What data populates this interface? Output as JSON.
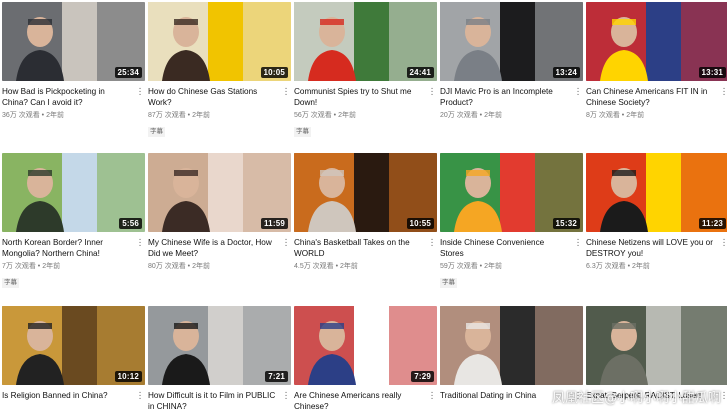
{
  "videos": [
    {
      "title": "How Bad is Pickpocketing in China? Can I avoid it?",
      "duration": "25:34",
      "views": "36万 次观看",
      "age": "2年前",
      "badge": "",
      "thumb_icon": "man-suit-thumbnail",
      "colors": [
        "#5a5e64",
        "#c9c4bd",
        "#2b2d33"
      ]
    },
    {
      "title": "How do Chinese Gas Stations Work?",
      "duration": "10:05",
      "views": "87万 次观看",
      "age": "2年前",
      "badge": "字幕",
      "thumb_icon": "gas-nozzle-thumbnail",
      "colors": [
        "#e8e4de",
        "#f1c400",
        "#3a2a22"
      ]
    },
    {
      "title": "Communist Spies try to Shut me Down!",
      "duration": "24:41",
      "views": "56万 次观看",
      "age": "2年前",
      "badge": "字幕",
      "thumb_icon": "army-cap-thumbnail",
      "colors": [
        "#dcd9d6",
        "#3f7a3a",
        "#d62b1f"
      ]
    },
    {
      "title": "DJI Mavic Pro is an Incomplete Product?",
      "duration": "13:24",
      "views": "20万 次观看",
      "age": "2年前",
      "badge": "",
      "thumb_icon": "drone-man-thumbnail",
      "colors": [
        "#b8bcc0",
        "#1c1c1e",
        "#7a7f86"
      ]
    },
    {
      "title": "Can Chinese Americans FIT IN in Chinese Society?",
      "duration": "13:31",
      "views": "8万 次观看",
      "age": "2年前",
      "badge": "",
      "thumb_icon": "flags-thumbnail",
      "colors": [
        "#d72a2a",
        "#2c3f86",
        "#ffd400"
      ]
    },
    {
      "title": "North Korean Border? Inner Mongolia? Northern China!",
      "duration": "5:56",
      "views": "7万 次观看",
      "age": "2年前",
      "badge": "字幕",
      "thumb_icon": "field-man-thumbnail",
      "colors": [
        "#7fae4a",
        "#c4d8e8",
        "#2d3a2a"
      ]
    },
    {
      "title": "My Chinese Wife is a Doctor, How Did we Meet?",
      "duration": "11:59",
      "views": "80万 次观看",
      "age": "2年前",
      "badge": "",
      "thumb_icon": "couple-thumbnail",
      "colors": [
        "#c8a488",
        "#e9d7cc",
        "#3b2b25"
      ]
    },
    {
      "title": "China's Basketball Takes on the WORLD",
      "duration": "10:55",
      "views": "4.5万 次观看",
      "age": "2年前",
      "badge": "",
      "thumb_icon": "basketball-thumbnail",
      "colors": [
        "#e57a20",
        "#2a1a10",
        "#cfc6bd"
      ]
    },
    {
      "title": "Inside Chinese Convenience Stores",
      "duration": "15:32",
      "views": "59万 次观看",
      "age": "2年前",
      "badge": "字幕",
      "thumb_icon": "store-sign-thumbnail",
      "colors": [
        "#1aa34a",
        "#e23b2f",
        "#f5a623"
      ]
    },
    {
      "title": "Chinese Netizens will LOVE you or DESTROY you!",
      "duration": "11:23",
      "views": "6.3万 次观看",
      "age": "2年前",
      "badge": "",
      "thumb_icon": "masked-flag-thumbnail",
      "colors": [
        "#d8211c",
        "#ffd400",
        "#1b1b1b"
      ]
    },
    {
      "title": "Is Religion Banned in China?",
      "duration": "10:12",
      "views": "",
      "age": "",
      "badge": "",
      "thumb_icon": "crucifix-thumbnail",
      "colors": [
        "#d9a640",
        "#6a4a20",
        "#222"
      ]
    },
    {
      "title": "How Difficult is it to Film in PUBLIC in CHINA?",
      "duration": "7:21",
      "views": "",
      "age": "",
      "badge": "",
      "thumb_icon": "street-man-thumbnail",
      "colors": [
        "#8b8f93",
        "#d1cfcc",
        "#1a1a1a"
      ]
    },
    {
      "title": "Are Chinese Americans really Chinese?",
      "duration": "7:29",
      "views": "",
      "age": "",
      "badge": "",
      "thumb_icon": "laughing-woman-thumbnail",
      "colors": [
        "#c43030",
        "#ffffff",
        "#2c3f86"
      ]
    },
    {
      "title": "Traditional Dating in China",
      "duration": "",
      "views": "",
      "age": "",
      "badge": "",
      "thumb_icon": "group-people-thumbnail",
      "colors": [
        "#c9a08c",
        "#2b2b2b",
        "#e8e6e3"
      ]
    },
    {
      "title": "Expat, Serpent, RACIST, Loser!",
      "duration": "",
      "views": "",
      "age": "",
      "badge": "",
      "thumb_icon": "crowd-street-thumbnail",
      "colors": [
        "#3f4a3a",
        "#b7b9b2",
        "#6c6f64"
      ]
    }
  ],
  "watermark": "凤凰社区@小啊小啊小甜瓜啊"
}
